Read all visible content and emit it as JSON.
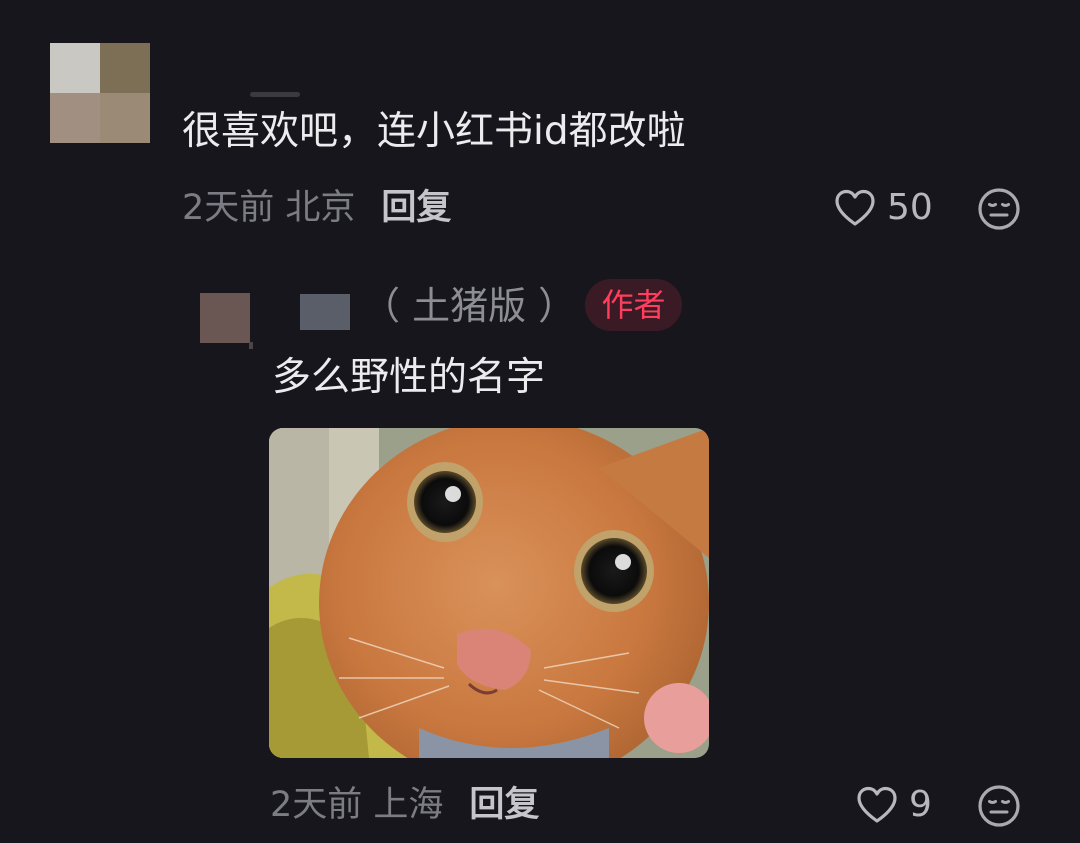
{
  "comment": {
    "text": "很喜欢吧，连小红书id都改啦",
    "time_location": "2天前 北京",
    "reply_label": "回复",
    "like_count": "50",
    "like_icon": "heart-outline-icon",
    "emoji_icon": "neutral-face-icon"
  },
  "reply": {
    "username_suffix": "（ 土猪版 ）",
    "author_badge": "作者",
    "text": "多么野性的名字",
    "image_icon": "cat-photo",
    "time_location": "2天前 上海",
    "reply_label": "回复",
    "like_count": "9",
    "like_icon": "heart-outline-icon",
    "emoji_icon": "neutral-face-icon"
  },
  "colors": {
    "background": "#17161c",
    "author_badge_text": "#ff3d5c",
    "author_badge_bg": "#3a1b25",
    "meta_text": "#7c7c84"
  }
}
